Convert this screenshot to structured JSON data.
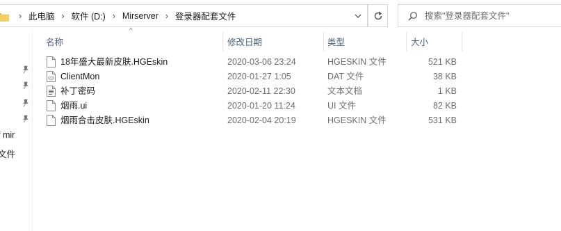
{
  "address_bar": {
    "breadcrumbs": [
      "此电脑",
      "软件 (D:)",
      "Mirserver",
      "登录器配套文件"
    ]
  },
  "search": {
    "placeholder": "搜索\"登录器配套文件\""
  },
  "nav_pane": {
    "partial_items": [
      "f mir",
      "文件"
    ]
  },
  "columns": {
    "name": "名称",
    "date": "修改日期",
    "type": "类型",
    "size": "大小"
  },
  "files": [
    {
      "name": "18年盛大最新皮肤.HGEskin",
      "date": "2020-03-06 23:24",
      "type": "HGESKIN 文件",
      "size": "521 KB",
      "icon": "blank-file-icon"
    },
    {
      "name": "ClientMon",
      "date": "2020-01-27 1:05",
      "type": "DAT 文件",
      "size": "38 KB",
      "icon": "vcd-file-icon"
    },
    {
      "name": "补丁密码",
      "date": "2020-02-11 22:30",
      "type": "文本文档",
      "size": "1 KB",
      "icon": "text-file-icon"
    },
    {
      "name": "烟雨.ui",
      "date": "2020-01-20 11:24",
      "type": "UI 文件",
      "size": "82 KB",
      "icon": "blank-file-icon"
    },
    {
      "name": "烟雨合击皮肤.HGEskin",
      "date": "2020-02-04 20:19",
      "type": "HGESKIN 文件",
      "size": "531 KB",
      "icon": "blank-file-icon"
    }
  ],
  "colors": {
    "folder": "#e8b84a",
    "header_text": "#4c607a",
    "border": "#d9d9d9"
  }
}
